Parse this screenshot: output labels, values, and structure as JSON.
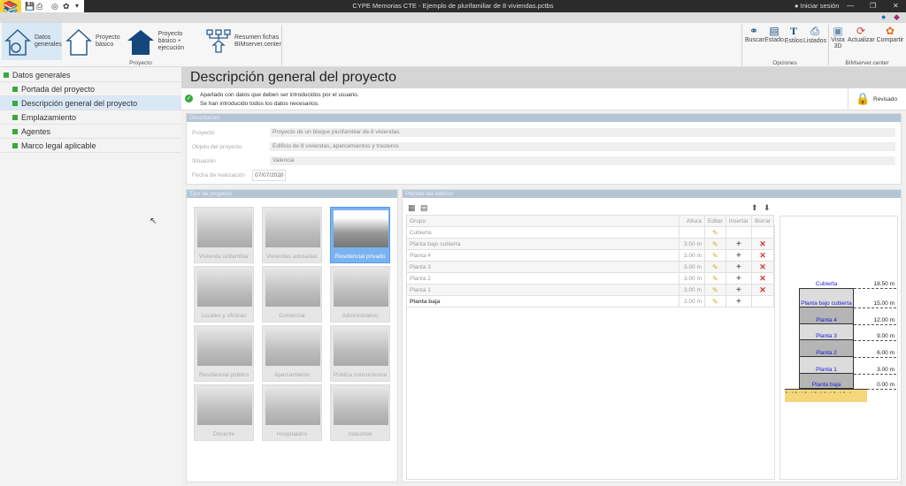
{
  "window": {
    "title": "CYPE Memorias CTE - Ejemplo de plurifamiliar de 8 viviendas.pctbs",
    "login": "Iniciar sesión",
    "minimize": "—",
    "maximize": "❐",
    "close": "✕"
  },
  "ribbon": {
    "project_buttons": [
      {
        "label": "Datos generales"
      },
      {
        "label": "Proyecto básico"
      },
      {
        "label": "Proyecto básico + ejecución"
      },
      {
        "label": "Resumen fichas BIMserver.center"
      }
    ],
    "project_group": "Proyecto",
    "option_buttons": [
      {
        "label": "Buscar"
      },
      {
        "label": "Estado"
      },
      {
        "label": "Estilos"
      },
      {
        "label": "Listados"
      }
    ],
    "options_group": "Opciones",
    "bim_buttons": [
      {
        "label": "Vista 3D"
      },
      {
        "label": "Actualizar"
      },
      {
        "label": "Compartir"
      }
    ],
    "bim_group": "BIMserver.center"
  },
  "sidebar": {
    "items": [
      {
        "label": "Datos generales"
      },
      {
        "label": "Portada del proyecto"
      },
      {
        "label": "Descripción general del proyecto"
      },
      {
        "label": "Emplazamiento"
      },
      {
        "label": "Agentes"
      },
      {
        "label": "Marco legal aplicable"
      }
    ]
  },
  "main": {
    "title": "Descripción general del proyecto",
    "status_line1": "Apartado con datos que deben ser introducidos por el usuario.",
    "status_line2": "Se han introducido todos los datos necesarios.",
    "reviewed": "Revisado",
    "description": {
      "header": "Descripción",
      "fields": [
        {
          "label": "Proyecto",
          "value": "Proyecto de un bloque plurifamiliar de 8 viviendas"
        },
        {
          "label": "Objeto del proyecto",
          "value": "Edificio de 8 viviendas, aparcamientos y trasteros"
        },
        {
          "label": "Situación",
          "value": "Valencia"
        }
      ],
      "date_label": "Fecha de realización",
      "date_value": "07/07/2020"
    },
    "project_type": {
      "header": "Tipo de proyecto",
      "selected": "Residencial privado",
      "tiles": [
        "Vivienda unifamiliar",
        "Viviendas adosadas",
        "Residencial privado",
        "Locales y oficinas",
        "Comercial",
        "Administrativo",
        "Residencial público",
        "Aparcamiento",
        "Pública concurrencia",
        "Docente",
        "Hospitalario",
        "Industrial"
      ]
    },
    "floors": {
      "header": "Plantas del edificio",
      "columns": [
        "Grupo",
        "Altura",
        "Editar",
        "Insertar",
        "Borrar"
      ],
      "rows": [
        {
          "name": "Cubierta",
          "height": "",
          "insert": false,
          "delete": false
        },
        {
          "name": "Planta bajo cubierta",
          "height": "3.50 m",
          "insert": true,
          "delete": true
        },
        {
          "name": "Planta 4",
          "height": "3.00 m",
          "insert": true,
          "delete": true
        },
        {
          "name": "Planta 3",
          "height": "3.00 m",
          "insert": true,
          "delete": true
        },
        {
          "name": "Planta 2",
          "height": "3.00 m",
          "insert": true,
          "delete": true
        },
        {
          "name": "Planta 1",
          "height": "3.00 m",
          "insert": true,
          "delete": true
        },
        {
          "name": "Planta baja",
          "height": "3.00 m",
          "insert": true,
          "delete": false
        }
      ],
      "diagram": [
        {
          "name": "Cubierta",
          "elevation": "18.50 m"
        },
        {
          "name": "Planta bajo cubierta",
          "elevation": "15.00 m"
        },
        {
          "name": "Planta 4",
          "elevation": "12.00 m"
        },
        {
          "name": "Planta 3",
          "elevation": "9.00 m"
        },
        {
          "name": "Planta 2",
          "elevation": "6.00 m"
        },
        {
          "name": "Planta 1",
          "elevation": "3.00 m"
        },
        {
          "name": "Planta baja",
          "elevation": "0.00 m"
        }
      ]
    }
  }
}
